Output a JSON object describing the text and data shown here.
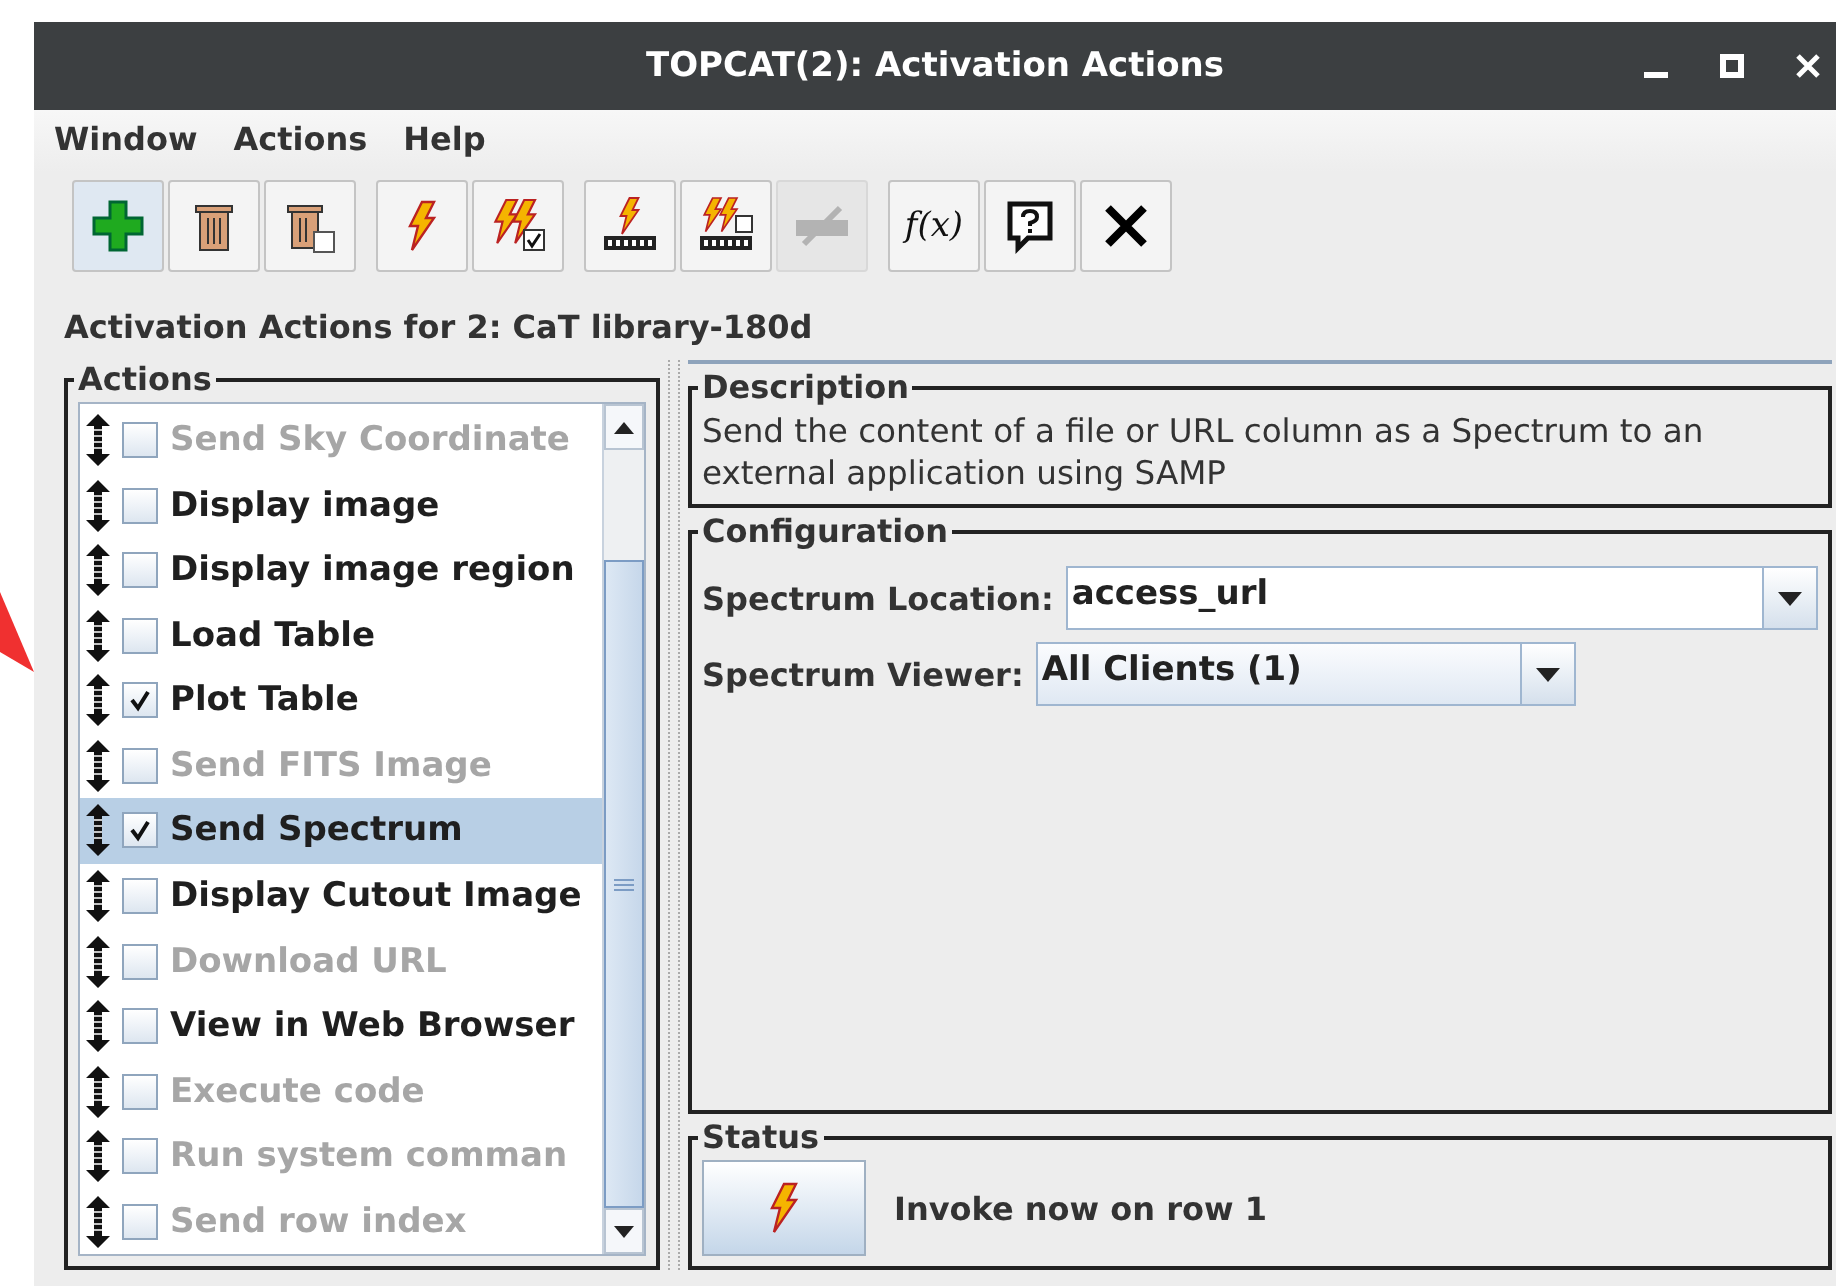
{
  "window": {
    "title": "TOPCAT(2): Activation Actions"
  },
  "menu": [
    "Window",
    "Actions",
    "Help"
  ],
  "toolbar": [
    {
      "buttons": [
        {
          "kind": "add",
          "disabled": false
        },
        {
          "kind": "delete",
          "disabled": false
        },
        {
          "kind": "delete-all",
          "disabled": false
        }
      ]
    },
    {
      "buttons": [
        {
          "kind": "invoke",
          "disabled": false
        },
        {
          "kind": "invoke-all",
          "disabled": false
        }
      ]
    },
    {
      "buttons": [
        {
          "kind": "invoke-table",
          "disabled": false
        },
        {
          "kind": "invoke-table-all",
          "disabled": false
        },
        {
          "kind": "invoke-table-off",
          "disabled": true
        }
      ]
    },
    {
      "buttons": [
        {
          "kind": "function",
          "disabled": false,
          "label": "f(x)"
        },
        {
          "kind": "help",
          "disabled": false
        },
        {
          "kind": "close",
          "disabled": false
        }
      ]
    }
  ],
  "heading": "Activation Actions for 2: CaT library-180d",
  "actions": {
    "title": "Actions",
    "items": [
      {
        "label": "Send Sky Coordinate",
        "enabled": false,
        "checked": false,
        "selected": false
      },
      {
        "label": "Display image",
        "enabled": true,
        "checked": false,
        "selected": false
      },
      {
        "label": "Display image region",
        "enabled": true,
        "checked": false,
        "selected": false
      },
      {
        "label": "Load Table",
        "enabled": true,
        "checked": false,
        "selected": false
      },
      {
        "label": "Plot Table",
        "enabled": true,
        "checked": true,
        "selected": false
      },
      {
        "label": "Send FITS Image",
        "enabled": false,
        "checked": false,
        "selected": false
      },
      {
        "label": "Send Spectrum",
        "enabled": true,
        "checked": true,
        "selected": true
      },
      {
        "label": "Display Cutout Image",
        "enabled": true,
        "checked": false,
        "selected": false
      },
      {
        "label": "Download URL",
        "enabled": false,
        "checked": false,
        "selected": false
      },
      {
        "label": "View in Web Browser",
        "enabled": true,
        "checked": false,
        "selected": false
      },
      {
        "label": "Execute code",
        "enabled": false,
        "checked": false,
        "selected": false
      },
      {
        "label": "Run system comman",
        "enabled": false,
        "checked": false,
        "selected": false
      },
      {
        "label": "Send row index",
        "enabled": false,
        "checked": false,
        "selected": false
      }
    ]
  },
  "description": {
    "title": "Description",
    "text": "Send the content of a file or URL column as a Spectrum to an external application using SAMP"
  },
  "configuration": {
    "title": "Configuration",
    "fields": [
      {
        "label": "Spectrum Location:",
        "value": "access_url",
        "kind": "editable"
      },
      {
        "label": "Spectrum Viewer:",
        "value": "All Clients (1)",
        "kind": "choice"
      }
    ]
  },
  "status": {
    "title": "Status",
    "message": "Invoke now on row 1"
  }
}
